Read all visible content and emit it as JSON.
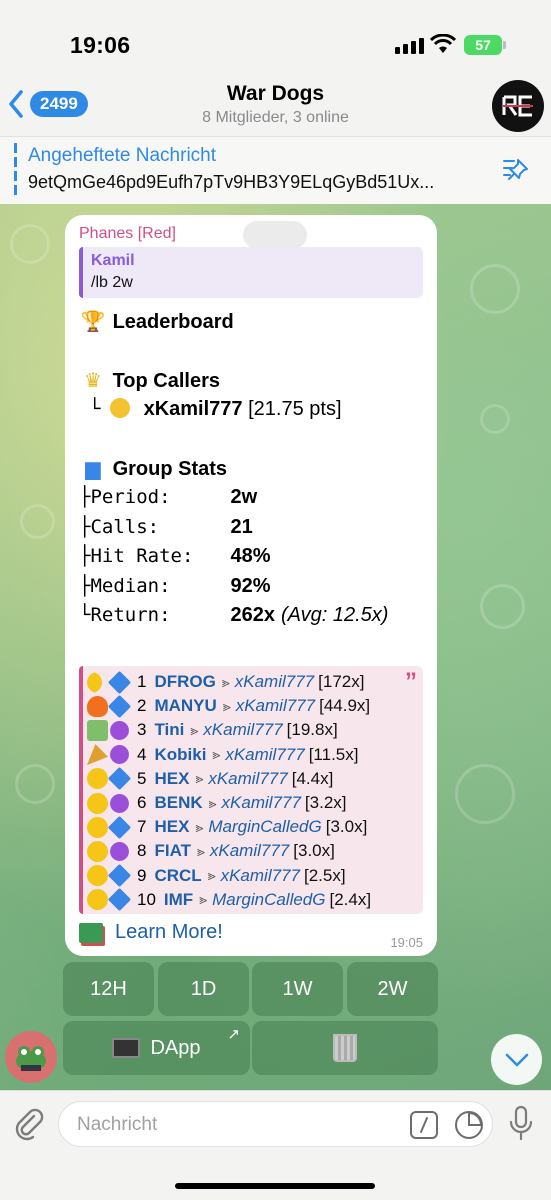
{
  "status_bar": {
    "time": "19:06",
    "battery": "57"
  },
  "header": {
    "back_count": "2499",
    "title": "War Dogs",
    "subtitle": "8 Mitglieder, 3 online"
  },
  "pinned": {
    "title": "Angeheftete Nachricht",
    "text": "9etQmGe46pd9Eufh7pTv9HB3Y9ELqGyBd51Ux..."
  },
  "message": {
    "sender": "Phanes [Red]",
    "reply": {
      "name": "Kamil",
      "text": "/lb 2w"
    },
    "leaderboard_title": "Leaderboard",
    "top_callers_title": "Top Callers",
    "top_caller": {
      "prefix": "└",
      "name": "xKamil777",
      "points": "[21.75 pts]"
    },
    "group_stats_title": "Group Stats",
    "stats": [
      {
        "prefix": "├",
        "label": "Period:",
        "value": "2w",
        "extra": ""
      },
      {
        "prefix": "├",
        "label": "Calls:",
        "value": "21",
        "extra": ""
      },
      {
        "prefix": "├",
        "label": "Hit Rate:",
        "value": "48%",
        "extra": ""
      },
      {
        "prefix": "├",
        "label": "Median:",
        "value": "92%",
        "extra": ""
      },
      {
        "prefix": "└",
        "label": "Return:",
        "value": "262x",
        "extra": "(Avg: 12.5x)"
      }
    ],
    "calls": [
      {
        "icon": "moon",
        "chain": "blue",
        "rank": "1",
        "ticker": "DFROG",
        "user": "xKamil777",
        "mult": "[172x]"
      },
      {
        "icon": "fire",
        "chain": "blue",
        "rank": "2",
        "ticker": "MANYU",
        "user": "xKamil777",
        "mult": "[44.9x]"
      },
      {
        "icon": "money",
        "chain": "purple",
        "rank": "3",
        "ticker": "Tini",
        "user": "xKamil777",
        "mult": "[19.8x]"
      },
      {
        "icon": "party",
        "chain": "purple",
        "rank": "4",
        "ticker": "Kobiki",
        "user": "xKamil777",
        "mult": "[11.5x]"
      },
      {
        "icon": "face",
        "chain": "blue",
        "rank": "5",
        "ticker": "HEX",
        "user": "xKamil777",
        "mult": "[4.4x]"
      },
      {
        "icon": "face",
        "chain": "purple",
        "rank": "6",
        "ticker": "BENK",
        "user": "xKamil777",
        "mult": "[3.2x]"
      },
      {
        "icon": "face",
        "chain": "blue",
        "rank": "7",
        "ticker": "HEX",
        "user": "MarginCalledG",
        "mult": "[3.0x]"
      },
      {
        "icon": "face",
        "chain": "purple",
        "rank": "8",
        "ticker": "FIAT",
        "user": "xKamil777",
        "mult": "[3.0x]"
      },
      {
        "icon": "face",
        "chain": "blue",
        "rank": "9",
        "ticker": "CRCL",
        "user": "xKamil777",
        "mult": "[2.5x]"
      },
      {
        "icon": "face",
        "chain": "blue",
        "rank": "10",
        "ticker": "IMF",
        "user": "MarginCalledG",
        "mult": "[2.4x]"
      }
    ],
    "learn_more": "Learn More!",
    "time": "19:05"
  },
  "keyboard": {
    "row1": [
      "12H",
      "1D",
      "1W",
      "2W"
    ],
    "dapp_label": "DApp"
  },
  "input": {
    "placeholder": "Nachricht"
  },
  "colors": {
    "accent": "#2f8ae5",
    "sender": "#d24f86",
    "reply": "#8a5bd6",
    "link": "#1e5fa8"
  }
}
